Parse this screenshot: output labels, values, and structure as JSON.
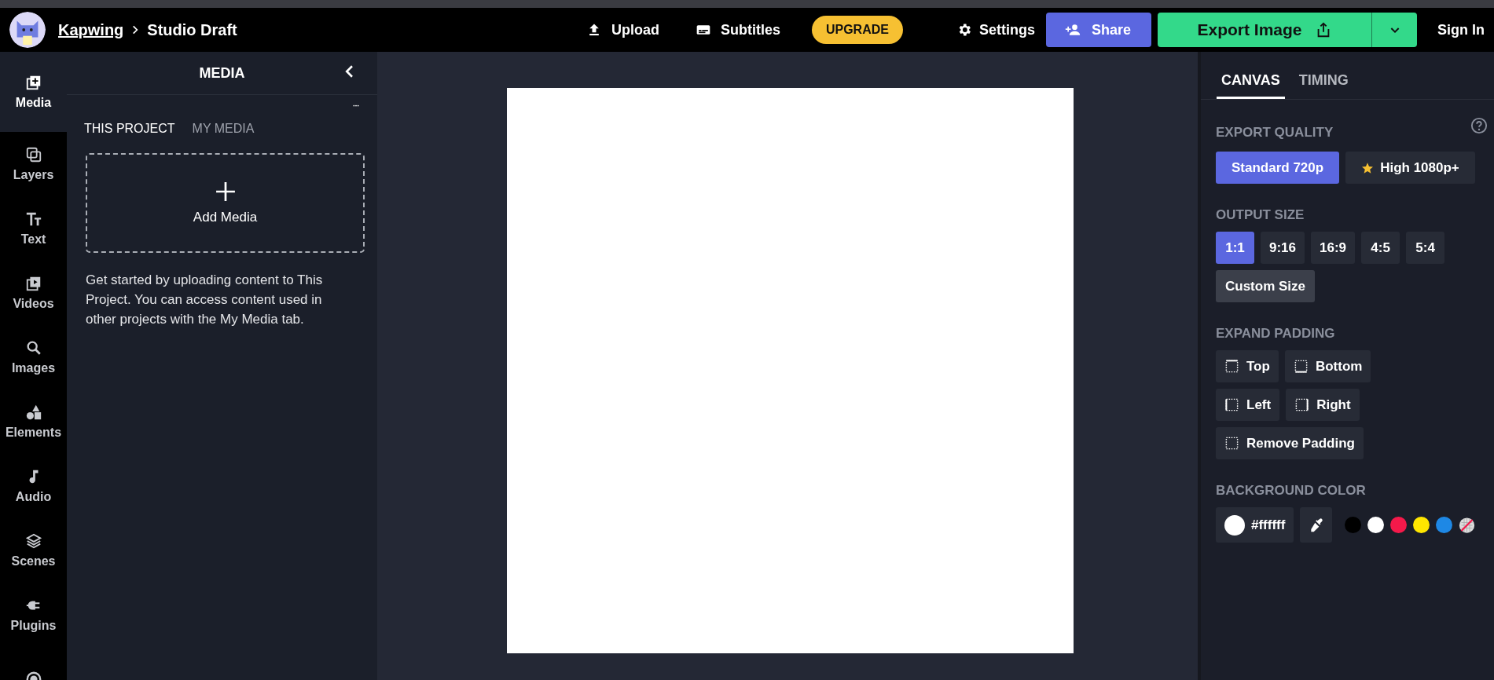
{
  "topbar": {
    "brand": "Kapwing",
    "project": "Studio Draft",
    "actions": [
      {
        "label": "Upload",
        "kind": "upload"
      },
      {
        "label": "Subtitles",
        "kind": "subtitles"
      },
      {
        "label": "UPGRADE",
        "kind": "upgrade"
      },
      {
        "label": "Settings",
        "kind": "settings"
      },
      {
        "label": "Share",
        "kind": "share"
      },
      {
        "label": "Export Image",
        "kind": "export"
      },
      {
        "label": "Sign In",
        "kind": "signin"
      }
    ]
  },
  "sidebar": {
    "items": [
      {
        "label": "Media",
        "kind": "media",
        "selected": true
      },
      {
        "label": "Layers",
        "kind": "layers",
        "selected": false
      },
      {
        "label": "Text",
        "kind": "text",
        "selected": false
      },
      {
        "label": "Videos",
        "kind": "videos",
        "selected": false
      },
      {
        "label": "Images",
        "kind": "images",
        "selected": false
      },
      {
        "label": "Elements",
        "kind": "elements",
        "selected": false
      },
      {
        "label": "Audio",
        "kind": "audio",
        "selected": false
      },
      {
        "label": "Scenes",
        "kind": "scenes",
        "selected": false
      },
      {
        "label": "Plugins",
        "kind": "plugins",
        "selected": false
      },
      {
        "kind": "record",
        "selected": false
      }
    ]
  },
  "media_panel": {
    "title": "MEDIA",
    "tabs": [
      {
        "label": "THIS PROJECT",
        "selected": true
      },
      {
        "label": "MY MEDIA",
        "selected": false
      }
    ],
    "add_media": "Add Media",
    "description": "Get started by uploading content to This Project. You can access content used in other projects with the My Media tab."
  },
  "inspector": {
    "tabs": [
      {
        "label": "CANVAS",
        "selected": true
      },
      {
        "label": "TIMING",
        "selected": false
      }
    ],
    "export_quality": {
      "heading": "EXPORT QUALITY",
      "options": [
        {
          "label": "Standard 720p",
          "selected": true,
          "premium": false
        },
        {
          "label": "High 1080p+",
          "selected": false,
          "premium": true
        }
      ]
    },
    "output_size": {
      "heading": "OUTPUT SIZE",
      "options": [
        {
          "label": "1:1",
          "selected": true
        },
        {
          "label": "9:16",
          "selected": false
        },
        {
          "label": "16:9",
          "selected": false
        },
        {
          "label": "4:5",
          "selected": false
        },
        {
          "label": "5:4",
          "selected": false
        }
      ],
      "custom": "Custom Size"
    },
    "expand_padding": {
      "heading": "EXPAND PADDING",
      "rows": [
        [
          {
            "label": "Top",
            "kind": "top"
          },
          {
            "label": "Bottom",
            "kind": "bottom"
          }
        ],
        [
          {
            "label": "Left",
            "kind": "left"
          },
          {
            "label": "Right",
            "kind": "right"
          }
        ],
        [
          {
            "label": "Remove Padding",
            "kind": "none"
          }
        ]
      ]
    },
    "background_color": {
      "heading": "BACKGROUND COLOR",
      "value": "#ffffff",
      "swatches": [
        {
          "kind": "solid",
          "color": "#000000"
        },
        {
          "kind": "solid",
          "color": "#ffffff"
        },
        {
          "kind": "solid",
          "color": "#f5194a"
        },
        {
          "kind": "solid",
          "color": "#ffe600"
        },
        {
          "kind": "solid",
          "color": "#1e88e5"
        },
        {
          "kind": "transparent"
        }
      ]
    }
  }
}
